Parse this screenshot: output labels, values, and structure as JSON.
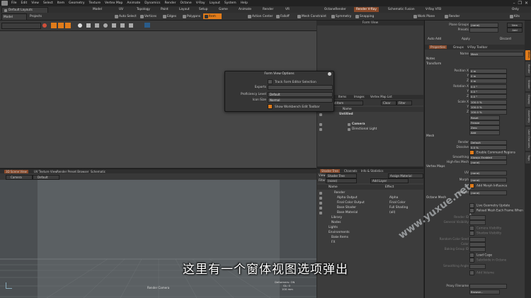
{
  "menubar": {
    "items": [
      "File",
      "Edit",
      "View",
      "Select",
      "Item",
      "Geometry",
      "Texture",
      "Vertex Map",
      "Animate",
      "Dynamics",
      "Render",
      "Octane",
      "V-Ray",
      "Layout",
      "System",
      "Help"
    ],
    "window_controls": [
      "–",
      "❐",
      "✕"
    ]
  },
  "layout": {
    "layout_dropdown": "Default Layouts",
    "tabs": [
      "Model",
      "Topology",
      "UV",
      "Paint",
      "Layout",
      "Setup",
      "Game",
      "Animate",
      "Render",
      "VR",
      "OctaneRender",
      "Render V-Ray",
      "Schematic Fusion",
      "V-Ray VFB"
    ],
    "selected_tab": "Render V-Ray",
    "only": "Only"
  },
  "toolbar": {
    "mode_dropdown": "Model",
    "projects_dropdown": "Projects",
    "buttons": [
      "Auto Select",
      "Vertices",
      "Edges",
      "Polygons",
      "Item",
      "Action Center",
      "Falloff",
      "Mesh Constraint",
      "Symmetry",
      "Snapping",
      "Work Plane",
      "Render",
      "Kits"
    ],
    "selected": "Item"
  },
  "form_view": {
    "title": "Form View"
  },
  "popup": {
    "title": "Form View Options",
    "track_label": "Track Form Editor Selection",
    "exports_label": "Exports",
    "proficiency_label": "Proficiency Level",
    "proficiency_value": "Default",
    "icon_size_label": "Icon Size",
    "icon_size_value": "Normal",
    "show_toolbar_label": "Show Workbench Edit Toolbar"
  },
  "items": {
    "tabs": [
      "Items",
      "Images",
      "Vertex Map List"
    ],
    "add_item": "Add Item",
    "clear": "Clear",
    "filter": "Filter",
    "header": "Name",
    "rows": [
      "Untitled",
      "Camera",
      "Directional Light"
    ]
  },
  "shader": {
    "tabs": [
      "Shader Tree",
      "Channels",
      "Info & Statistics"
    ],
    "view_label": "View",
    "view_value": "Shader Tree",
    "assign_material": "Assign Material",
    "filter_label": "Filter",
    "filter_value": "(none)",
    "add_layer": "Add Layer",
    "col_name": "Name",
    "col_effect": "Effect",
    "rows": [
      {
        "name": "Render",
        "effect": ""
      },
      {
        "name": "Alpha Output",
        "effect": "Alpha"
      },
      {
        "name": "Final Color Output",
        "effect": "Final Color"
      },
      {
        "name": "Base Shader",
        "effect": "Full Shading"
      },
      {
        "name": "Base Material",
        "effect": "(all)"
      },
      {
        "name": "Library",
        "effect": ""
      },
      {
        "name": "Nodes",
        "effect": ""
      },
      {
        "name": "Lights",
        "effect": ""
      },
      {
        "name": "Environments",
        "effect": ""
      },
      {
        "name": "Bake Items",
        "effect": ""
      },
      {
        "name": "FX",
        "effect": ""
      }
    ]
  },
  "bottom_viewport": {
    "tabs": [
      "3D Scene View",
      "UV Texture View",
      "Render Preset Browser",
      "Schematic"
    ],
    "camera_dropdown": "Camera",
    "shading_dropdown": "Default",
    "label": "Render Camera",
    "deformers": "Deformers: ON",
    "gl": "GL: 0",
    "scale": "100 mm"
  },
  "properties": {
    "plane_groups_label": "Plane Groups",
    "plane_groups_value": "(none)",
    "presets_label": "Presets",
    "new_label": "New",
    "add_label": "Add",
    "auto_add": "Auto Add",
    "apply": "Apply",
    "discard": "Discard",
    "tabs": [
      "Properties",
      "Groups",
      "V-Ray Toolbar"
    ],
    "name_label": "Name",
    "name_value": "Mesh",
    "sections": {
      "notes": "Notes",
      "transform": "Transform",
      "mesh": "Mesh",
      "vertex_maps": "Vertex Maps",
      "octane_mesh": "Octane Mesh"
    },
    "position_label": "Position X",
    "position": [
      "0 m",
      "0 m",
      "0 m"
    ],
    "rotation_label": "Rotation X",
    "rotation": [
      "0.0 °",
      "0.0 °",
      "0.0 °"
    ],
    "scale_label": "Scale X",
    "scale": [
      "100.0 %",
      "100.0 %",
      "100.0 %"
    ],
    "axis_y": "Y",
    "axis_z": "Z",
    "reset": "Reset",
    "freeze": "Freeze",
    "zero": "Zero",
    "add": "Add",
    "render_label": "Render",
    "render_value": "Default",
    "dissolve_label": "Dissolve",
    "dissolve_value": "0.0 %",
    "enable_cmd": "Enable Command Regions",
    "smoothing_label": "Smoothing",
    "smoothing_value": "Always Enabled",
    "highres_label": "High-Res Mesh",
    "highres_value": "(none)",
    "uv_label": "UV",
    "uv_value": "(none)",
    "morph_label": "Morph",
    "morph_value": "(none)",
    "add_morph": "Add Morph Influence",
    "weight_label": "Weight",
    "weight_value": "(none)",
    "live_geo": "Live Geometry Update",
    "reload_mesh": "Reload Mesh Each Frame When A...",
    "render_id": "Render ID",
    "general_vis": "General Visibility",
    "camera_vis": "Camera Visibility",
    "shadow_vis": "Shadow Visibility",
    "random_seed": "Random Color Seed",
    "color": "Color",
    "baking_group": "Baking Group ID",
    "load_cage": "Load Cage",
    "subdivide": "Subdivide in Octane",
    "smoothing_angle": "Smoothing Angle",
    "add_volume": "Add Volume",
    "proxy_label": "Proxy Filename",
    "browse": "Browse...",
    "vertical_tabs": [
      "Mesh",
      "Render",
      "Shader",
      "Display",
      "Assembly",
      "User Channels",
      "Tags"
    ]
  },
  "subtitle": "这里有一个窗体视图选项弹出",
  "watermark": "www.yuxue.net",
  "colors": {
    "accent": "#e07b1a",
    "panel": "#393939",
    "viewport_top": "#474747",
    "viewport_bottom": "#5c6164"
  }
}
